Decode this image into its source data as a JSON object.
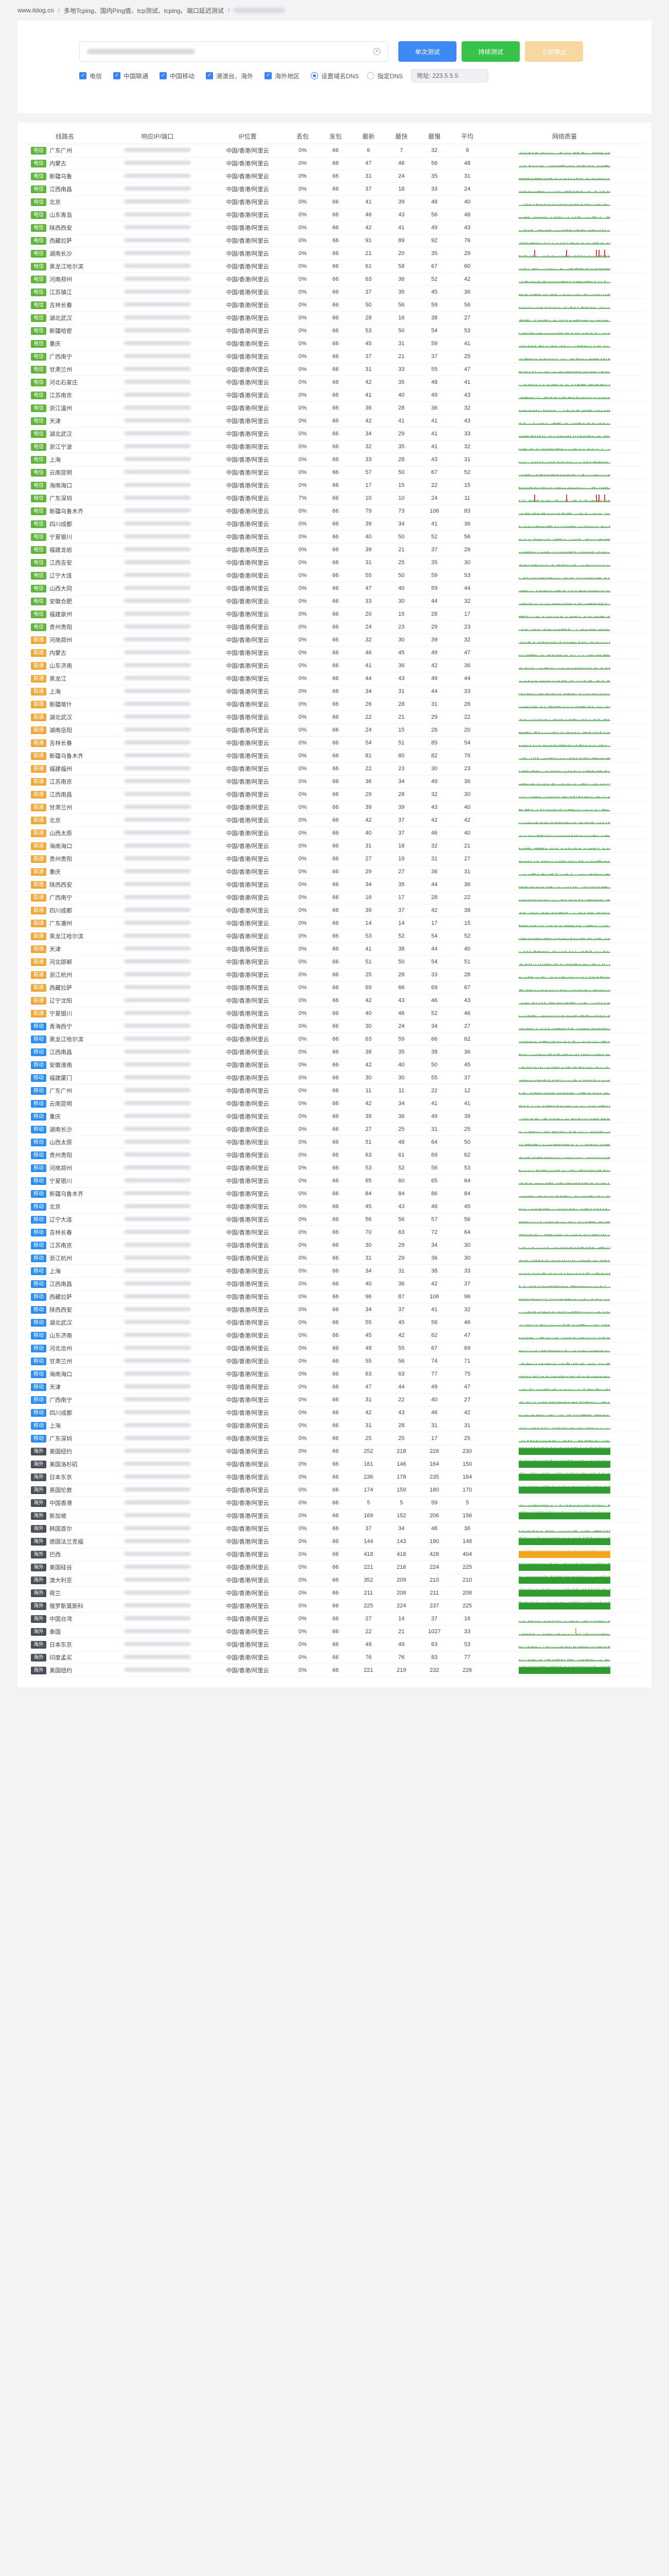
{
  "breadcrumb": {
    "home": "www.itdog.cn",
    "sep": "/",
    "item": "多地Tcping、国内Ping值、tcp测试、tcping、端口延迟测试"
  },
  "search": {
    "clear_icon": "close-icon"
  },
  "buttons": {
    "single": "单次测试",
    "continuous": "持续测试",
    "stop": "立即停止"
  },
  "filters": {
    "items": [
      "电信",
      "中国联通",
      "中国移动",
      "港澳台、海外",
      "海外地区"
    ],
    "radio": [
      "设置域名DNS",
      "指定DNS"
    ],
    "ip_label": "地址: 223.5.5.5"
  },
  "table": {
    "headers": [
      "线路名",
      "响应IP/端口",
      "IP位置",
      "丢包",
      "发包",
      "最新",
      "最快",
      "最慢",
      "平均",
      "网络质量"
    ]
  },
  "colors": {
    "telecom": "#60b33d",
    "unicom": "#f0a83a",
    "mobile": "#2b8ef0",
    "overseas": "#4a4f57",
    "good": "#2e9c2e",
    "warn": "#f4a51c",
    "bad": "#e03a3a"
  },
  "rows": [
    [
      "电信",
      "广东广州",
      "中国/香港/阿里云",
      "0%",
      66,
      6,
      7,
      32,
      9,
      "g"
    ],
    [
      "电信",
      "内蒙古",
      "中国/香港/阿里云",
      "0%",
      66,
      47,
      46,
      56,
      48,
      "g"
    ],
    [
      "电信",
      "新疆乌鲁",
      "中国/香港/阿里云",
      "0%",
      66,
      31,
      24,
      35,
      31,
      "g"
    ],
    [
      "电信",
      "江西南昌",
      "中国/香港/阿里云",
      "0%",
      66,
      37,
      18,
      33,
      24,
      "g"
    ],
    [
      "电信",
      "北京",
      "中国/香港/阿里云",
      "0%",
      66,
      41,
      39,
      48,
      40,
      "g"
    ],
    [
      "电信",
      "山东青岛",
      "中国/香港/阿里云",
      "0%",
      66,
      46,
      43,
      56,
      48,
      "g"
    ],
    [
      "电信",
      "陕西西安",
      "中国/香港/阿里云",
      "0%",
      66,
      42,
      41,
      49,
      43,
      "g"
    ],
    [
      "电信",
      "西藏拉萨",
      "中国/香港/阿里云",
      "0%",
      66,
      91,
      89,
      92,
      76,
      "g"
    ],
    [
      "电信",
      "湖南长沙",
      "中国/香港/阿里云",
      "0%",
      66,
      21,
      20,
      35,
      29,
      "r"
    ],
    [
      "电信",
      "黑龙江哈尔滨",
      "中国/香港/阿里云",
      "0%",
      66,
      61,
      58,
      67,
      60,
      "g"
    ],
    [
      "电信",
      "河南郑州",
      "中国/香港/阿里云",
      "0%",
      66,
      63,
      36,
      52,
      42,
      "g"
    ],
    [
      "电信",
      "江苏镇江",
      "中国/香港/阿里云",
      "0%",
      66,
      37,
      35,
      45,
      36,
      "g"
    ],
    [
      "电信",
      "吉林长春",
      "中国/香港/阿里云",
      "0%",
      66,
      50,
      56,
      59,
      56,
      "g"
    ],
    [
      "电信",
      "湖北武汉",
      "中国/香港/阿里云",
      "0%",
      66,
      28,
      16,
      38,
      27,
      "g"
    ],
    [
      "电信",
      "新疆哈密",
      "中国/香港/阿里云",
      "0%",
      66,
      53,
      50,
      54,
      53,
      "g"
    ],
    [
      "电信",
      "重庆",
      "中国/香港/阿里云",
      "0%",
      66,
      45,
      31,
      59,
      41,
      "g"
    ],
    [
      "电信",
      "广西南宁",
      "中国/香港/阿里云",
      "0%",
      66,
      37,
      21,
      37,
      25,
      "g"
    ],
    [
      "电信",
      "甘肃兰州",
      "中国/香港/阿里云",
      "0%",
      66,
      31,
      33,
      55,
      47,
      "g"
    ],
    [
      "电信",
      "河北石家庄",
      "中国/香港/阿里云",
      "0%",
      66,
      42,
      35,
      48,
      41,
      "g"
    ],
    [
      "电信",
      "江苏南京",
      "中国/香港/阿里云",
      "0%",
      66,
      41,
      40,
      49,
      43,
      "g"
    ],
    [
      "电信",
      "浙江温州",
      "中国/香港/阿里云",
      "0%",
      66,
      36,
      28,
      36,
      32,
      "g"
    ],
    [
      "电信",
      "天津",
      "中国/香港/阿里云",
      "0%",
      66,
      42,
      41,
      41,
      43,
      "g"
    ],
    [
      "电信",
      "湖北武汉",
      "中国/香港/阿里云",
      "0%",
      66,
      34,
      29,
      41,
      33,
      "g"
    ],
    [
      "电信",
      "浙江宁波",
      "中国/香港/阿里云",
      "0%",
      66,
      32,
      35,
      41,
      32,
      "g"
    ],
    [
      "电信",
      "上海",
      "中国/香港/阿里云",
      "0%",
      66,
      33,
      28,
      43,
      31,
      "g"
    ],
    [
      "电信",
      "云南昆明",
      "中国/香港/阿里云",
      "0%",
      66,
      57,
      50,
      67,
      52,
      "g"
    ],
    [
      "电信",
      "海南海口",
      "中国/香港/阿里云",
      "0%",
      66,
      17,
      15,
      22,
      15,
      "g"
    ],
    [
      "电信",
      "广东深圳",
      "中国/香港/阿里云",
      "7%",
      66,
      10,
      10,
      24,
      11,
      "r"
    ],
    [
      "电信",
      "新疆乌鲁木齐",
      "中国/香港/阿里云",
      "0%",
      66,
      79,
      73,
      106,
      83,
      "g"
    ],
    [
      "电信",
      "四川成都",
      "中国/香港/阿里云",
      "0%",
      66,
      39,
      34,
      41,
      36,
      "g"
    ],
    [
      "电信",
      "宁夏银川",
      "中国/香港/阿里云",
      "0%",
      66,
      40,
      50,
      52,
      56,
      "g"
    ],
    [
      "电信",
      "福建龙岩",
      "中国/香港/阿里云",
      "0%",
      66,
      39,
      21,
      37,
      29,
      "g"
    ],
    [
      "电信",
      "江西吉安",
      "中国/香港/阿里云",
      "0%",
      66,
      31,
      25,
      35,
      30,
      "g"
    ],
    [
      "电信",
      "辽宁大连",
      "中国/香港/阿里云",
      "0%",
      66,
      55,
      50,
      59,
      53,
      "g"
    ],
    [
      "电信",
      "山西大同",
      "中国/香港/阿里云",
      "0%",
      66,
      47,
      40,
      59,
      44,
      "g"
    ],
    [
      "电信",
      "安徽合肥",
      "中国/香港/阿里云",
      "0%",
      66,
      33,
      30,
      44,
      32,
      "g"
    ],
    [
      "电信",
      "福建泉州",
      "中国/香港/阿里云",
      "0%",
      66,
      20,
      15,
      28,
      17,
      "g"
    ],
    [
      "电信",
      "贵州贵阳",
      "中国/香港/阿里云",
      "0%",
      66,
      24,
      23,
      29,
      23,
      "g"
    ],
    [
      "联通",
      "河南郑州",
      "中国/香港/阿里云",
      "0%",
      66,
      32,
      30,
      39,
      32,
      "g"
    ],
    [
      "联通",
      "内蒙古",
      "中国/香港/阿里云",
      "0%",
      66,
      46,
      45,
      49,
      47,
      "g"
    ],
    [
      "联通",
      "山东济南",
      "中国/香港/阿里云",
      "0%",
      66,
      41,
      36,
      42,
      36,
      "g"
    ],
    [
      "联通",
      "黑龙江",
      "中国/香港/阿里云",
      "0%",
      66,
      44,
      43,
      49,
      44,
      "g"
    ],
    [
      "联通",
      "上海",
      "中国/香港/阿里云",
      "0%",
      66,
      34,
      31,
      44,
      33,
      "g"
    ],
    [
      "联通",
      "新疆喀什",
      "中国/香港/阿里云",
      "0%",
      66,
      26,
      28,
      31,
      28,
      "g"
    ],
    [
      "联通",
      "湖北武汉",
      "中国/香港/阿里云",
      "0%",
      66,
      22,
      21,
      29,
      22,
      "g"
    ],
    [
      "联通",
      "湖南岳阳",
      "中国/香港/阿里云",
      "0%",
      66,
      24,
      15,
      28,
      20,
      "g"
    ],
    [
      "联通",
      "吉林长春",
      "中国/香港/阿里云",
      "0%",
      66,
      54,
      51,
      85,
      54,
      "g"
    ],
    [
      "联通",
      "新疆乌鲁木齐",
      "中国/香港/阿里云",
      "0%",
      66,
      81,
      80,
      82,
      76,
      "g"
    ],
    [
      "联通",
      "福建福州",
      "中国/香港/阿里云",
      "0%",
      66,
      22,
      23,
      30,
      23,
      "g"
    ],
    [
      "联通",
      "江苏南京",
      "中国/香港/阿里云",
      "0%",
      66,
      36,
      34,
      49,
      36,
      "g"
    ],
    [
      "联通",
      "江西南昌",
      "中国/香港/阿里云",
      "0%",
      66,
      29,
      28,
      32,
      30,
      "g"
    ],
    [
      "联通",
      "甘肃兰州",
      "中国/香港/阿里云",
      "0%",
      66,
      39,
      39,
      43,
      40,
      "g"
    ],
    [
      "联通",
      "北京",
      "中国/香港/阿里云",
      "0%",
      66,
      42,
      37,
      42,
      42,
      "g"
    ],
    [
      "联通",
      "山西太原",
      "中国/香港/阿里云",
      "0%",
      66,
      40,
      37,
      46,
      40,
      "g"
    ],
    [
      "联通",
      "海南海口",
      "中国/香港/阿里云",
      "0%",
      66,
      31,
      18,
      32,
      21,
      "g"
    ],
    [
      "联通",
      "贵州贵阳",
      "中国/香港/阿里云",
      "0%",
      66,
      27,
      19,
      31,
      27,
      "g"
    ],
    [
      "联通",
      "重庆",
      "中国/香港/阿里云",
      "0%",
      66,
      29,
      27,
      36,
      31,
      "g"
    ],
    [
      "联通",
      "陕西西安",
      "中国/香港/阿里云",
      "0%",
      66,
      34,
      35,
      44,
      36,
      "g"
    ],
    [
      "联通",
      "广西南宁",
      "中国/香港/阿里云",
      "0%",
      66,
      16,
      17,
      28,
      22,
      "g"
    ],
    [
      "联通",
      "四川成都",
      "中国/香港/阿里云",
      "0%",
      66,
      39,
      37,
      42,
      38,
      "g"
    ],
    [
      "联通",
      "广东潮州",
      "中国/香港/阿里云",
      "0%",
      66,
      14,
      14,
      17,
      15,
      "g"
    ],
    [
      "联通",
      "黑龙江哈尔滨",
      "中国/香港/阿里云",
      "0%",
      66,
      53,
      52,
      54,
      52,
      "g"
    ],
    [
      "联通",
      "天津",
      "中国/香港/阿里云",
      "0%",
      66,
      41,
      38,
      44,
      40,
      "g"
    ],
    [
      "联通",
      "河北邯郸",
      "中国/香港/阿里云",
      "0%",
      66,
      51,
      50,
      54,
      51,
      "g"
    ],
    [
      "联通",
      "浙江杭州",
      "中国/香港/阿里云",
      "0%",
      66,
      25,
      28,
      33,
      28,
      "g"
    ],
    [
      "联通",
      "西藏拉萨",
      "中国/香港/阿里云",
      "0%",
      66,
      69,
      66,
      69,
      67,
      "g"
    ],
    [
      "联通",
      "辽宁沈阳",
      "中国/香港/阿里云",
      "0%",
      66,
      42,
      43,
      46,
      43,
      "g"
    ],
    [
      "联通",
      "宁夏银川",
      "中国/香港/阿里云",
      "0%",
      66,
      40,
      46,
      52,
      46,
      "g"
    ],
    [
      "移动",
      "青海西宁",
      "中国/香港/阿里云",
      "0%",
      66,
      30,
      24,
      34,
      27,
      "g"
    ],
    [
      "移动",
      "黑龙江哈尔滨",
      "中国/香港/阿里云",
      "0%",
      66,
      63,
      59,
      66,
      62,
      "g"
    ],
    [
      "移动",
      "江西南昌",
      "中国/香港/阿里云",
      "0%",
      66,
      38,
      35,
      38,
      36,
      "g"
    ],
    [
      "移动",
      "安徽淮南",
      "中国/香港/阿里云",
      "0%",
      66,
      42,
      40,
      50,
      45,
      "g"
    ],
    [
      "移动",
      "福建厦门",
      "中国/香港/阿里云",
      "0%",
      66,
      30,
      30,
      55,
      37,
      "g"
    ],
    [
      "移动",
      "广东广州",
      "中国/香港/阿里云",
      "0%",
      66,
      11,
      11,
      22,
      12,
      "g"
    ],
    [
      "移动",
      "云南昆明",
      "中国/香港/阿里云",
      "0%",
      66,
      42,
      34,
      41,
      41,
      "g"
    ],
    [
      "移动",
      "重庆",
      "中国/香港/阿里云",
      "0%",
      66,
      39,
      36,
      49,
      39,
      "g"
    ],
    [
      "移动",
      "湖南长沙",
      "中国/香港/阿里云",
      "0%",
      66,
      27,
      25,
      31,
      25,
      "g"
    ],
    [
      "移动",
      "山西太原",
      "中国/香港/阿里云",
      "0%",
      66,
      51,
      48,
      64,
      50,
      "g"
    ],
    [
      "移动",
      "贵州贵阳",
      "中国/香港/阿里云",
      "0%",
      66,
      63,
      61,
      69,
      62,
      "g"
    ],
    [
      "移动",
      "河南郑州",
      "中国/香港/阿里云",
      "0%",
      66,
      53,
      52,
      56,
      53,
      "g"
    ],
    [
      "移动",
      "宁夏银川",
      "中国/香港/阿里云",
      "0%",
      66,
      65,
      60,
      65,
      64,
      "g"
    ],
    [
      "移动",
      "新疆乌鲁木齐",
      "中国/香港/阿里云",
      "0%",
      66,
      84,
      84,
      86,
      84,
      "g"
    ],
    [
      "移动",
      "北京",
      "中国/香港/阿里云",
      "0%",
      66,
      45,
      43,
      46,
      45,
      "g"
    ],
    [
      "移动",
      "辽宁大连",
      "中国/香港/阿里云",
      "0%",
      66,
      56,
      56,
      57,
      56,
      "g"
    ],
    [
      "移动",
      "吉林长春",
      "中国/香港/阿里云",
      "0%",
      66,
      70,
      63,
      72,
      64,
      "g"
    ],
    [
      "移动",
      "江苏南京",
      "中国/香港/阿里云",
      "0%",
      66,
      30,
      29,
      34,
      30,
      "g"
    ],
    [
      "移动",
      "浙江杭州",
      "中国/香港/阿里云",
      "0%",
      66,
      31,
      29,
      36,
      30,
      "g"
    ],
    [
      "移动",
      "上海",
      "中国/香港/阿里云",
      "0%",
      66,
      34,
      31,
      38,
      33,
      "g"
    ],
    [
      "移动",
      "江西南昌",
      "中国/香港/阿里云",
      "0%",
      66,
      40,
      36,
      42,
      37,
      "g"
    ],
    [
      "移动",
      "西藏拉萨",
      "中国/香港/阿里云",
      "0%",
      66,
      96,
      87,
      106,
      96,
      "g"
    ],
    [
      "移动",
      "陕西西安",
      "中国/香港/阿里云",
      "0%",
      66,
      34,
      37,
      41,
      32,
      "g"
    ],
    [
      "移动",
      "湖北武汉",
      "中国/香港/阿里云",
      "0%",
      66,
      55,
      45,
      56,
      46,
      "g"
    ],
    [
      "移动",
      "山东济南",
      "中国/香港/阿里云",
      "0%",
      66,
      45,
      42,
      62,
      47,
      "g"
    ],
    [
      "移动",
      "河北沧州",
      "中国/香港/阿里云",
      "0%",
      66,
      49,
      55,
      67,
      69,
      "g"
    ],
    [
      "移动",
      "甘肃兰州",
      "中国/香港/阿里云",
      "0%",
      66,
      55,
      56,
      74,
      71,
      "g"
    ],
    [
      "移动",
      "海南海口",
      "中国/香港/阿里云",
      "0%",
      66,
      63,
      63,
      77,
      75,
      "g"
    ],
    [
      "移动",
      "天津",
      "中国/香港/阿里云",
      "0%",
      66,
      47,
      44,
      49,
      47,
      "g"
    ],
    [
      "移动",
      "广西南宁",
      "中国/香港/阿里云",
      "0%",
      66,
      31,
      22,
      40,
      27,
      "g"
    ],
    [
      "移动",
      "四川成都",
      "中国/香港/阿里云",
      "0%",
      66,
      42,
      43,
      46,
      42,
      "g"
    ],
    [
      "移动",
      "上海",
      "中国/香港/阿里云",
      "0%",
      66,
      31,
      28,
      31,
      31,
      "g"
    ],
    [
      "移动",
      "广东深圳",
      "中国/香港/阿里云",
      "0%",
      66,
      25,
      25,
      17,
      25,
      "g"
    ],
    [
      "海外",
      "美国纽约",
      "中国/香港/阿里云",
      "0%",
      66,
      252,
      218,
      226,
      230,
      "d"
    ],
    [
      "海外",
      "美国洛杉矶",
      "中国/香港/阿里云",
      "0%",
      66,
      161,
      146,
      164,
      150,
      "d"
    ],
    [
      "海外",
      "日本东京",
      "中国/香港/阿里云",
      "0%",
      66,
      236,
      178,
      235,
      184,
      "d"
    ],
    [
      "海外",
      "英国伦敦",
      "中国/香港/阿里云",
      "0%",
      66,
      174,
      159,
      180,
      170,
      "d"
    ],
    [
      "海外",
      "中国香港",
      "中国/香港/阿里云",
      "0%",
      66,
      5,
      5,
      59,
      5,
      "g"
    ],
    [
      "海外",
      "新加坡",
      "中国/香港/阿里云",
      "0%",
      66,
      169,
      152,
      206,
      156,
      "d"
    ],
    [
      "海外",
      "韩国首尔",
      "中国/香港/阿里云",
      "0%",
      66,
      37,
      34,
      48,
      36,
      "g"
    ],
    [
      "海外",
      "德国法兰克福",
      "中国/香港/阿里云",
      "0%",
      66,
      144,
      143,
      190,
      148,
      "d"
    ],
    [
      "海外",
      "巴西",
      "中国/香港/阿里云",
      "0%",
      66,
      418,
      418,
      428,
      404,
      "y"
    ],
    [
      "海外",
      "美国硅谷",
      "中国/香港/阿里云",
      "0%",
      66,
      221,
      216,
      224,
      225,
      "d"
    ],
    [
      "海外",
      "澳大利亚",
      "中国/香港/阿里云",
      "0%",
      66,
      352,
      209,
      210,
      210,
      "d"
    ],
    [
      "海外",
      "荷兰",
      "中国/香港/阿里云",
      "0%",
      66,
      211,
      208,
      211,
      208,
      "d"
    ],
    [
      "海外",
      "俄罗斯莫斯科",
      "中国/香港/阿里云",
      "0%",
      66,
      225,
      224,
      237,
      225,
      "d"
    ],
    [
      "海外",
      "中国台湾",
      "中国/香港/阿里云",
      "0%",
      66,
      27,
      14,
      37,
      16,
      "g"
    ],
    [
      "海外",
      "泰国",
      "中国/香港/阿里云",
      "0%",
      66,
      22,
      21,
      1027,
      33,
      "o"
    ],
    [
      "海外",
      "日本东京",
      "中国/香港/阿里云",
      "0%",
      66,
      49,
      49,
      63,
      53,
      "g"
    ],
    [
      "海外",
      "印度孟买",
      "中国/香港/阿里云",
      "0%",
      66,
      76,
      76,
      83,
      77,
      "g"
    ],
    [
      "海外",
      "美国纽约",
      "中国/香港/阿里云",
      "0%",
      66,
      221,
      219,
      232,
      226,
      "d"
    ]
  ]
}
